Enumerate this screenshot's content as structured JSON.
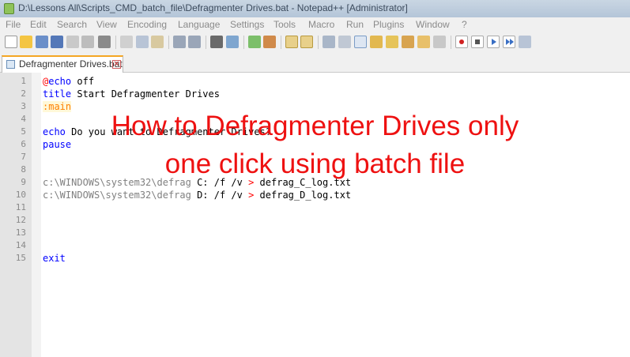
{
  "window": {
    "title": "D:\\Lessons All\\Scripts_CMD_batch_file\\Defragmenter Drives.bat - Notepad++ [Administrator]"
  },
  "menu": [
    "File",
    "Edit",
    "Search",
    "View",
    "Encoding",
    "Language",
    "Settings",
    "Tools",
    "Macro",
    "Run",
    "Plugins",
    "Window",
    "?"
  ],
  "toolbar_icons": [
    "new-file-icon",
    "open-file-icon",
    "save-icon",
    "save-all-icon",
    "close-icon",
    "close-all-icon",
    "print-icon",
    "cut-icon",
    "copy-icon",
    "paste-icon",
    "undo-icon",
    "redo-icon",
    "find-icon",
    "replace-icon",
    "zoom-in-icon",
    "zoom-out-icon",
    "sync-vertical-icon",
    "sync-horizontal-icon",
    "word-wrap-icon",
    "show-all-chars-icon",
    "indent-guide-icon",
    "udl-icon",
    "doc-map-icon",
    "function-list-icon",
    "folder-workspace-icon",
    "monitor-icon",
    "record-macro-icon",
    "stop-record-icon",
    "play-macro-icon",
    "run-macro-multiple-icon",
    "save-macro-icon"
  ],
  "tab": {
    "label": "Defragmenter Drives.bat",
    "close": "✕"
  },
  "lines": {
    "n1": "1",
    "n2": "2",
    "n3": "3",
    "n4": "4",
    "n5": "5",
    "n6": "6",
    "n7": "7",
    "n8": "8",
    "n9": "9",
    "n10": "10",
    "n11": "11",
    "n12": "12",
    "n13": "13",
    "n14": "14",
    "n15": "15",
    "l1_at": "@",
    "l1_kw": "echo",
    "l1_rest": " off",
    "l2_kw": "title",
    "l2_rest": " Start Defragmenter Drives",
    "l3_label": ":main",
    "l5_kw": "echo",
    "l5_rest": " Do you want to Defragmenter Drives?",
    "l6_kw": "pause",
    "l9_path": "c:\\WINDOWS\\system32\\defrag",
    "l9_args": " C: /f /v ",
    "l9_op": ">",
    "l9_out": " defrag_C_log.txt",
    "l10_path": "c:\\WINDOWS\\system32\\defrag",
    "l10_args": " D: /f /v ",
    "l10_op": ">",
    "l10_out": " defrag_D_log.txt",
    "l15_kw": "exit"
  },
  "overlay": {
    "line1": "How to Defragmenter Drives only",
    "line2": "one click using batch file"
  }
}
